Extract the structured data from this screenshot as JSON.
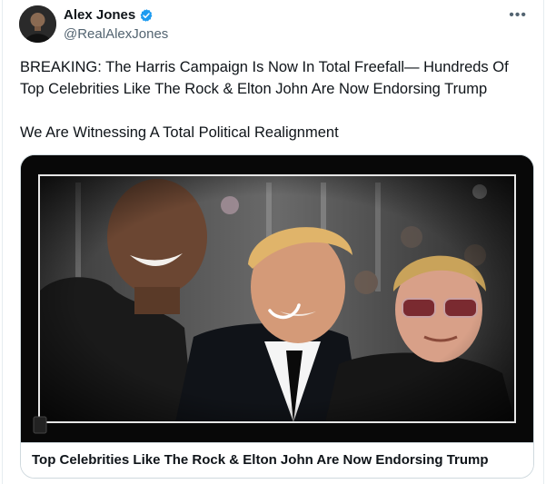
{
  "author": {
    "name": "Alex Jones",
    "handle": "@RealAlexJones",
    "verified_icon": "verified-badge-icon",
    "avatar_icon": "avatar"
  },
  "menu": {
    "more_label": "•••"
  },
  "tweet": {
    "paragraphs": [
      "BREAKING: The Harris Campaign Is Now In Total Freefall— Hundreds Of Top Celebrities Like The Rock & Elton John Are Now Endorsing Trump",
      "We Are Witnessing A Total Political Realignment"
    ]
  },
  "card": {
    "caption": "Top Celebrities Like The Rock & Elton John Are Now Endorsing Trump"
  },
  "colors": {
    "text": "#0f1419",
    "secondary": "#536471",
    "verified": "#1d9bf0",
    "border": "#cfd9de"
  }
}
